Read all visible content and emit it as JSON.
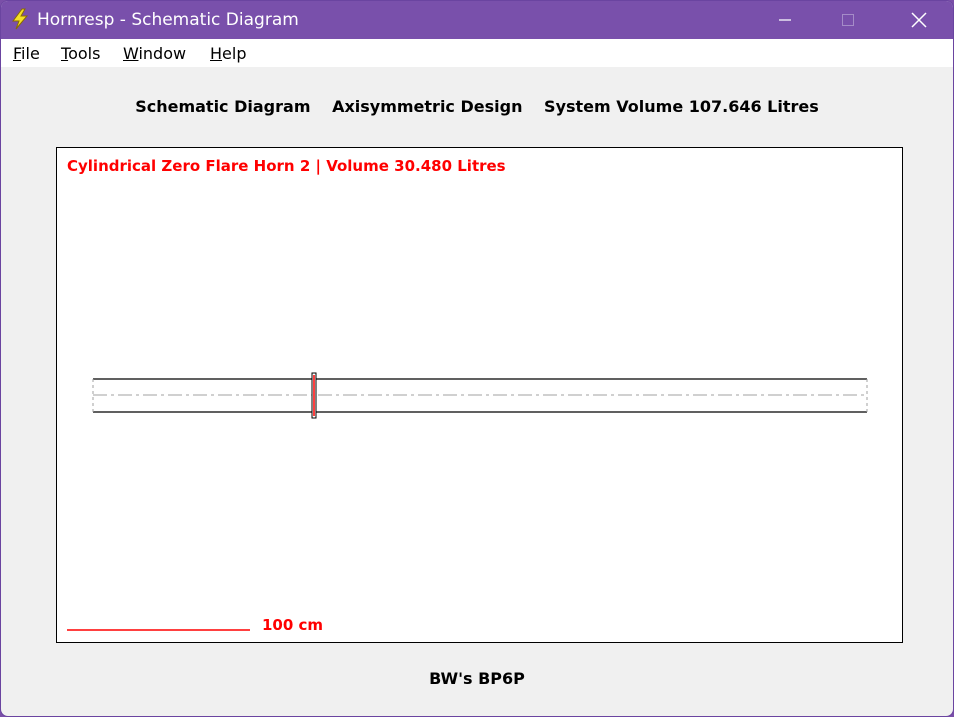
{
  "window": {
    "title": "Hornresp - Schematic Diagram",
    "icon": "lightning-bolt-icon",
    "controls": {
      "minimize": "minimize-icon",
      "maximize": "maximize-icon",
      "close": "close-icon"
    }
  },
  "menu": {
    "items": [
      {
        "label": "File",
        "accel": "F",
        "rest": "ile"
      },
      {
        "label": "Tools",
        "accel": "T",
        "rest": "ools"
      },
      {
        "label": "Window",
        "accel": "W",
        "rest": "indow"
      },
      {
        "label": "Help",
        "accel": "H",
        "rest": "elp"
      }
    ]
  },
  "header": {
    "diagram_label": "Schematic Diagram",
    "design_label": "Axisymmetric Design",
    "system_volume": "System Volume 107.646 Litres"
  },
  "diagram": {
    "horn_title": "Cylindrical Zero Flare Horn 2 | Volume 30.480 Litres",
    "scale_label": "100 cm",
    "colors": {
      "accent": "#ff0000",
      "outline": "#000000",
      "centerline": "#a0a0a0"
    }
  },
  "footer": {
    "label": "BW's BP6P"
  }
}
